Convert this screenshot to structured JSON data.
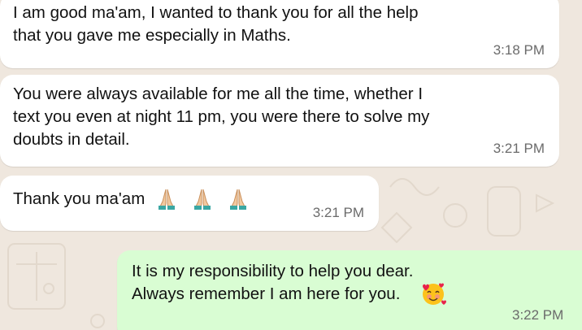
{
  "colors": {
    "wallpaper": "#efe7de",
    "incoming_bubble": "#ffffff",
    "outgoing_bubble": "#d9fdd3",
    "timestamp": "#6b6b6b"
  },
  "messages": [
    {
      "direction": "incoming",
      "text": "I am good ma'am, I wanted to thank you for all the help\nthat you gave me especially in Maths.",
      "time": "3:18 PM"
    },
    {
      "direction": "incoming",
      "text": "You were always available for me all the time, whether I\ntext you even at night 11 pm, you were there to solve my\ndoubts in detail.",
      "time": "3:21 PM"
    },
    {
      "direction": "incoming",
      "text": "Thank you ma'am",
      "emoji": [
        "folded-hands-icon",
        "folded-hands-icon",
        "folded-hands-icon"
      ],
      "time": "3:21 PM"
    },
    {
      "direction": "outgoing",
      "text": "It is my responsibility to help you dear.\nAlways remember I am here for you.",
      "emoji": [
        "smiling-face-with-hearts-icon"
      ],
      "time": "3:22 PM"
    }
  ]
}
